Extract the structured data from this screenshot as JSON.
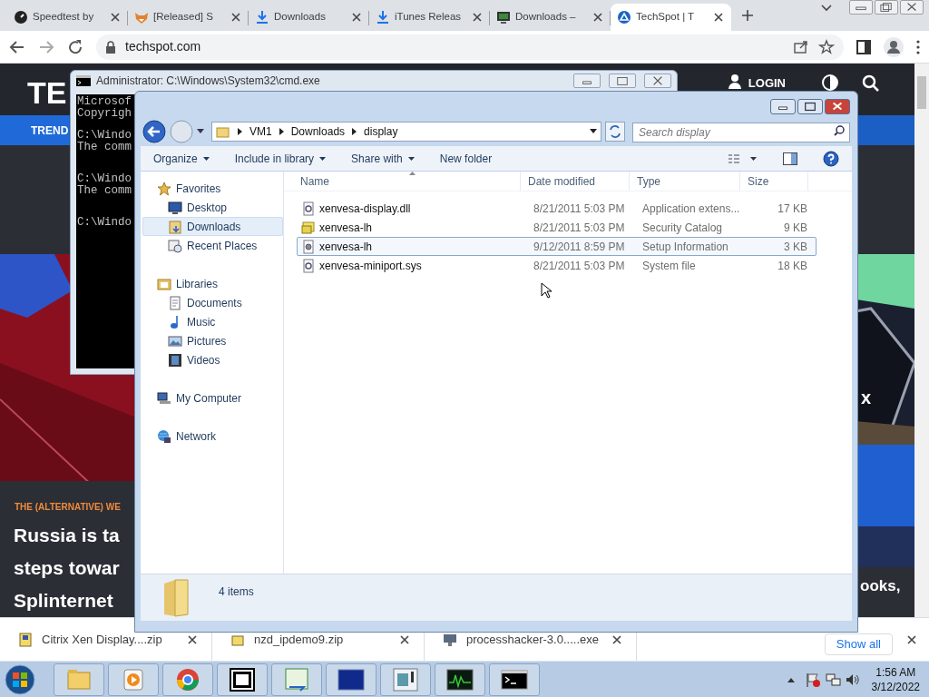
{
  "browser": {
    "tabs": [
      {
        "title": "Speedtest by",
        "selected": false
      },
      {
        "title": "[Released] S",
        "selected": false
      },
      {
        "title": "Downloads",
        "selected": false
      },
      {
        "title": "iTunes Releas",
        "selected": false
      },
      {
        "title": "Downloads –",
        "selected": false
      },
      {
        "title": "TechSpot | T",
        "selected": true
      }
    ],
    "address": "techspot.com"
  },
  "page": {
    "logo": "TE",
    "login": "LOGIN",
    "nav_item": "TREND",
    "kicker": "THE (ALTERNATIVE) WE",
    "headline_lines": [
      "Russia is ta",
      "steps towar",
      "Splinternet"
    ],
    "side_text": "x",
    "side_headline": "ooks,"
  },
  "cmd": {
    "title": "Administrator: C:\\Windows\\System32\\cmd.exe",
    "blocks": [
      {
        "lines": [
          "Microsof",
          "Copyrigh"
        ]
      },
      {
        "lines": [
          "C:\\Windo",
          "The comm"
        ]
      },
      {
        "lines": [
          "C:\\Windo",
          "The comm"
        ]
      },
      {
        "lines": [
          "C:\\Windo"
        ]
      }
    ]
  },
  "explorer": {
    "breadcrumb": [
      "VM1",
      "Downloads",
      "display"
    ],
    "search": {
      "placeholder": "Search display"
    },
    "toolbar": [
      {
        "label": "Organize",
        "dropdown": true
      },
      {
        "label": "Include in library",
        "dropdown": true
      },
      {
        "label": "Share with",
        "dropdown": true
      },
      {
        "label": "New folder",
        "dropdown": false
      }
    ],
    "nav": [
      {
        "label": "Favorites",
        "children": [
          {
            "label": "Desktop",
            "selected": false
          },
          {
            "label": "Downloads",
            "selected": true
          },
          {
            "label": "Recent Places",
            "selected": false
          }
        ]
      },
      {
        "label": "Libraries",
        "children": [
          {
            "label": "Documents",
            "selected": false
          },
          {
            "label": "Music",
            "selected": false
          },
          {
            "label": "Pictures",
            "selected": false
          },
          {
            "label": "Videos",
            "selected": false
          }
        ]
      },
      {
        "label": "My Computer"
      },
      {
        "label": "Network"
      }
    ],
    "columns": [
      "Name",
      "Date modified",
      "Type",
      "Size"
    ],
    "rows": [
      {
        "name": "xenvesa-display.dll",
        "date": "8/21/2011 5:03 PM",
        "type": "Application extens...",
        "size": "17 KB",
        "selected": false
      },
      {
        "name": "xenvesa-lh",
        "date": "8/21/2011 5:03 PM",
        "type": "Security Catalog",
        "size": "9 KB",
        "selected": false
      },
      {
        "name": "xenvesa-lh",
        "date": "9/12/2011 8:59 PM",
        "type": "Setup Information",
        "size": "3 KB",
        "selected": true
      },
      {
        "name": "xenvesa-miniport.sys",
        "date": "8/21/2011 5:03 PM",
        "type": "System file",
        "size": "18 KB",
        "selected": false
      }
    ],
    "status": "4 items"
  },
  "downloads": {
    "items": [
      "Citrix Xen Display....zip",
      "nzd_ipdemo9.zip",
      "processhacker-3.0.....exe"
    ],
    "show_all": "Show all"
  },
  "taskbar": {
    "time": "1:56 AM",
    "date": "3/12/2022"
  }
}
